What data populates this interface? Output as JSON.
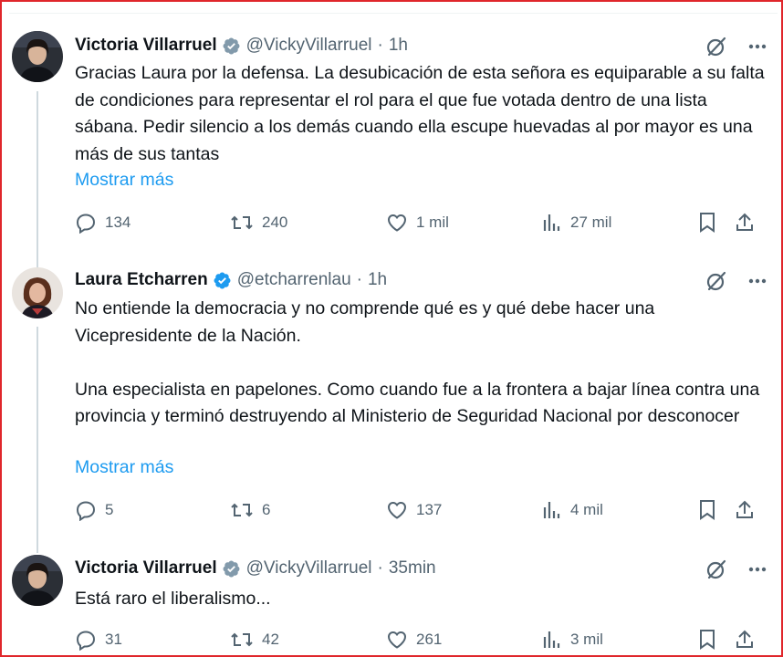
{
  "tweets": [
    {
      "name": "Victoria Villarruel",
      "handle": "@VickyVillarruel",
      "time": "1h",
      "text": "Gracias Laura por la defensa. La desubicación de esta señora es equiparable a su falta de condiciones para representar el rol para el que fue votada dentro de una lista sábana. Pedir silencio a los demás cuando ella escupe huevadas al por mayor es una más de sus tantas",
      "show_more": "Mostrar más",
      "replies": "134",
      "reposts": "240",
      "likes": "1 mil",
      "views": "27 mil",
      "badge_color": "#829aab"
    },
    {
      "name": "Laura Etcharren",
      "handle": "@etcharrenlau",
      "time": "1h",
      "text": "No entiende la democracia y no comprende qué es y qué debe hacer una Vicepresidente de la Nación.\n\nUna especialista en papelones. Como cuando fue a la frontera a bajar línea contra una provincia y terminó destruyendo al Ministerio de Seguridad Nacional por desconocer",
      "show_more": "Mostrar más",
      "replies": "5",
      "reposts": "6",
      "likes": "137",
      "views": "4 mil",
      "badge_color": "#1d9bf0"
    },
    {
      "name": "Victoria Villarruel",
      "handle": "@VickyVillarruel",
      "time": "35min",
      "text": "Está raro el liberalismo...",
      "replies": "31",
      "reposts": "42",
      "likes": "261",
      "views": "3 mil",
      "badge_color": "#829aab"
    }
  ],
  "colors": {
    "link": "#1d9bf0",
    "muted": "#536471",
    "frame": "#e0262b",
    "thread": "#cfd9de"
  }
}
